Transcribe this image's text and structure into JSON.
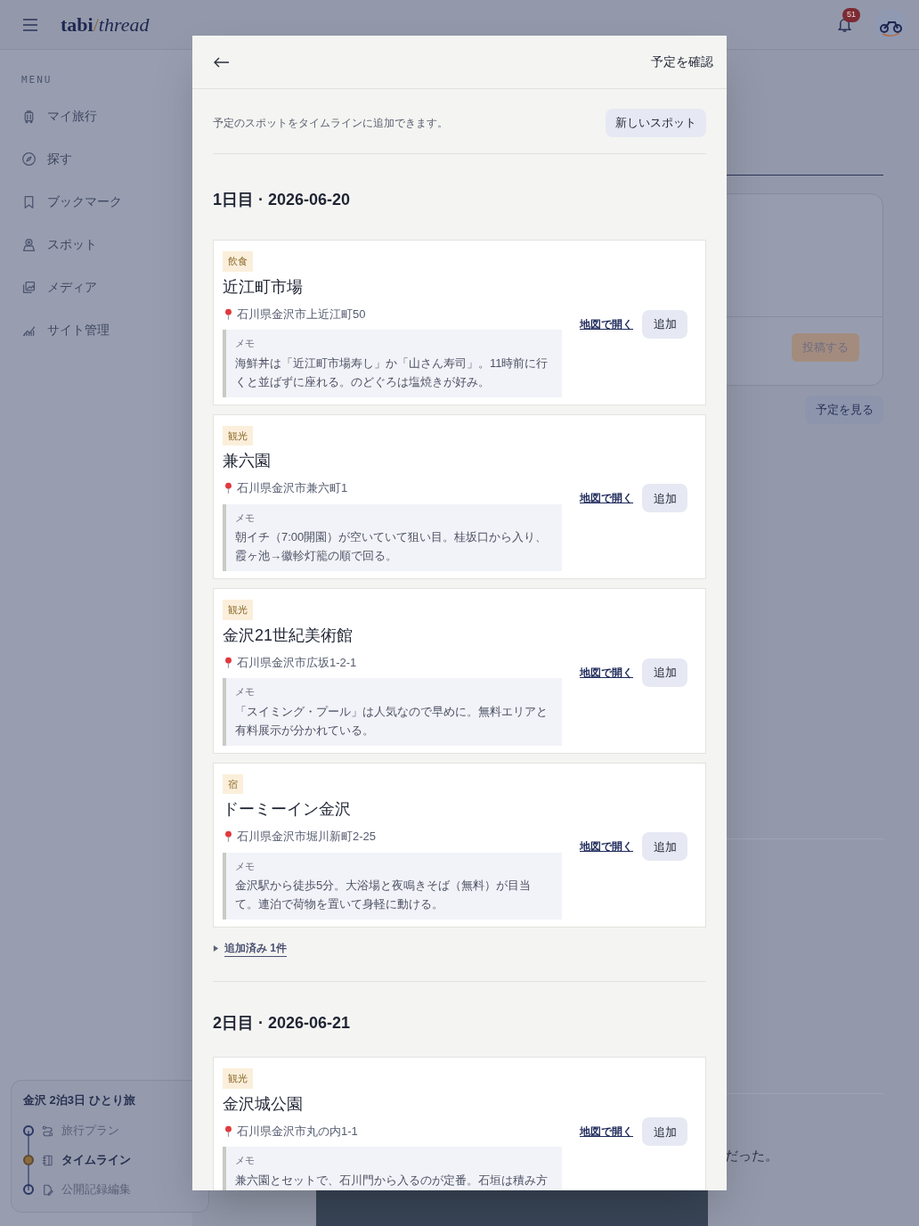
{
  "header": {
    "logo": {
      "first": "tabi",
      "separator": "/",
      "second": "thread"
    },
    "notification_count": "51"
  },
  "sidebar": {
    "heading": "MENU",
    "items": [
      {
        "label": "マイ旅行"
      },
      {
        "label": "探す"
      },
      {
        "label": "ブックマーク"
      },
      {
        "label": "スポット"
      },
      {
        "label": "メディア"
      },
      {
        "label": "サイト管理"
      }
    ],
    "trip": {
      "title": "金沢 2泊3日 ひとり旅",
      "steps": [
        {
          "label": "旅行プラン",
          "selected": false
        },
        {
          "label": "タイムライン",
          "selected": true
        },
        {
          "label": "公開記録編集",
          "selected": false
        }
      ]
    }
  },
  "background": {
    "post_button": "投稿する",
    "schedule_button": "予定を見る",
    "text_fragment": "だった。"
  },
  "modal": {
    "title": "予定を確認",
    "intro": "予定のスポットをタイムラインに追加できます。",
    "new_spot_button": "新しいスポット",
    "days": [
      {
        "heading": "1日目 · 2026-06-20",
        "spots": [
          {
            "category": "飲食",
            "name": "近江町市場",
            "address": "石川県金沢市上近江町50",
            "memo_label": "メモ",
            "memo": "海鮮丼は「近江町市場寿し」か「山さん寿司」。11時前に行くと並ばずに座れる。のどぐろは塩焼きが好み。",
            "map_link": "地図で開く",
            "add_button": "追加"
          },
          {
            "category": "観光",
            "name": "兼六園",
            "address": "石川県金沢市兼六町1",
            "memo_label": "メモ",
            "memo": "朝イチ（7:00開園）が空いていて狙い目。桂坂口から入り、霞ヶ池→徽軫灯籠の順で回る。",
            "map_link": "地図で開く",
            "add_button": "追加"
          },
          {
            "category": "観光",
            "name": "金沢21世紀美術館",
            "address": "石川県金沢市広坂1-2-1",
            "memo_label": "メモ",
            "memo": "「スイミング・プール」は人気なので早めに。無料エリアと有料展示が分かれている。",
            "map_link": "地図で開く",
            "add_button": "追加"
          },
          {
            "category": "宿",
            "name": "ドーミーイン金沢",
            "address": "石川県金沢市堀川新町2-25",
            "memo_label": "メモ",
            "memo": "金沢駅から徒歩5分。大浴場と夜鳴きそば（無料）が目当て。連泊で荷物を置いて身軽に動ける。",
            "map_link": "地図で開く",
            "add_button": "追加"
          }
        ],
        "added_toggle": "追加済み 1件"
      },
      {
        "heading": "2日目 · 2026-06-21",
        "spots": [
          {
            "category": "観光",
            "name": "金沢城公園",
            "address": "石川県金沢市丸の内1-1",
            "memo_label": "メモ",
            "memo": "兼六園とセットで、石川門から入るのが定番。石垣は積み方",
            "map_link": "地図で開く",
            "add_button": "追加"
          }
        ]
      }
    ]
  }
}
